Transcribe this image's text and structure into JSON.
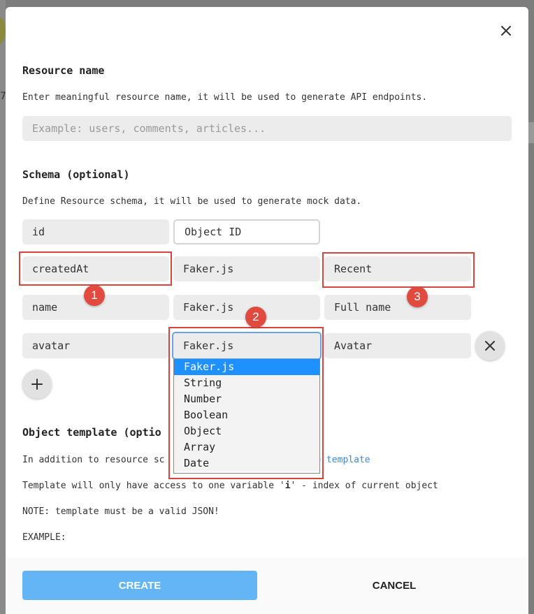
{
  "background": {
    "partial_text": "7"
  },
  "modal": {
    "resource": {
      "title": "Resource name",
      "description": "Enter meaningful resource name, it will be used to generate API endpoints.",
      "placeholder": "Example: users, comments, articles..."
    },
    "schema": {
      "title": "Schema (optional)",
      "description": "Define Resource schema, it will be used to generate mock data.",
      "rows": [
        {
          "name": "id",
          "type": "Object ID",
          "generator": ""
        },
        {
          "name": "createdAt",
          "type": "Faker.js",
          "generator": "Recent"
        },
        {
          "name": "name",
          "type": "Faker.js",
          "generator": "Full name"
        },
        {
          "name": "avatar",
          "type": "Faker.js",
          "generator": "Avatar"
        }
      ],
      "type_options": [
        "Faker.js",
        "String",
        "Number",
        "Boolean",
        "Object",
        "Array",
        "Date"
      ],
      "selected_type": "Faker.js"
    },
    "template": {
      "title": "Object template (optio",
      "line1_a": "In addition to resource sc",
      "line1_link": "he template",
      "line2_a": "Template will only have access to one variable '",
      "line2_var": "i",
      "line2_b": "' - index of current object",
      "line3": "NOTE: template must be a valid JSON!",
      "line4": "EXAMPLE:"
    },
    "footer": {
      "create_label": "CREATE",
      "cancel_label": "CANCEL"
    }
  },
  "annotations": [
    "1",
    "2",
    "3"
  ],
  "colors": {
    "accent": "#64b5f6",
    "highlight": "#1e90ff",
    "annotation": "#d9433d",
    "link": "#3e86d6"
  }
}
